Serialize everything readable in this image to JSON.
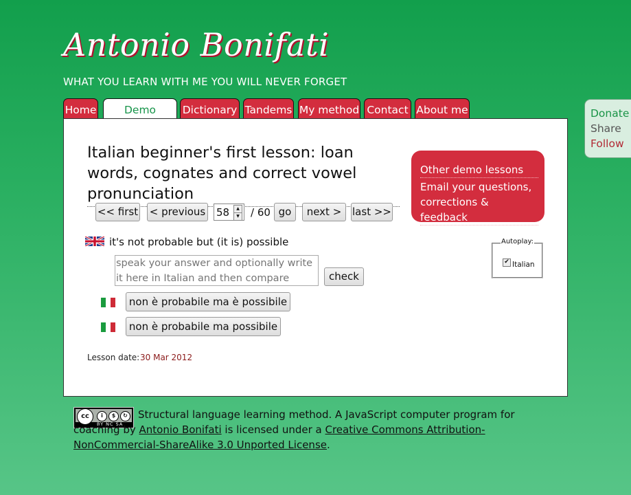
{
  "header": {
    "site_title": "Antonio Bonifati",
    "tagline": "WHAT YOU LEARN WITH ME YOU WILL NEVER FORGET"
  },
  "nav": {
    "tabs": [
      {
        "label": "Home",
        "active": false
      },
      {
        "label": "Demo lessons",
        "active": true
      },
      {
        "label": "Dictionary",
        "active": false
      },
      {
        "label": "Tandems",
        "active": false
      },
      {
        "label": "My method",
        "active": false
      },
      {
        "label": "Contact",
        "active": false
      },
      {
        "label": "About me",
        "active": false
      }
    ]
  },
  "lesson": {
    "title": "Italian beginner's first lesson: loan words, cognates and correct vowel pronunciation",
    "pagination": {
      "first_label": "<< first",
      "previous_label": "< previous",
      "current_page": "58",
      "total_label": "/ 60",
      "go_label": "go",
      "next_label": "next >",
      "last_label": "last >>"
    },
    "prompt": {
      "source_flag": "uk-flag",
      "text": "it's not probable but (it is) possible"
    },
    "answer": {
      "placeholder": "speak your answer and optionally write it here in Italian and then compare",
      "value": ""
    },
    "check_label": "check",
    "translations": [
      {
        "flag": "italy-flag",
        "text": "non è probabile ma è possibile"
      },
      {
        "flag": "italy-flag",
        "text": "non è probabile ma possibile"
      }
    ],
    "date_label": "Lesson date:",
    "date_value": "30 Mar 2012"
  },
  "side_links": {
    "other_lessons": "Other demo lessons",
    "email": "Email your questions, corrections & feedback"
  },
  "autoplay": {
    "legend": "Autoplay:",
    "option_label": "Italian",
    "checked": true
  },
  "floating": {
    "donate": "Donate",
    "share": "Share",
    "follow": "Follow"
  },
  "footer": {
    "badge_text": "BY NC SA",
    "text_1": "Structural language learning method. A JavaScript computer program for coaching by",
    "author_link": "Antonio Bonifati",
    "text_2": "is licensed under a",
    "license_link": "Creative Commons Attribution-NonCommercial-ShareAlike 3.0 Unported License",
    "text_3": "."
  },
  "colors": {
    "background_green": "#2bb062",
    "tab_red": "#d32d3e",
    "active_tab_text": "#17944a",
    "date_color": "#8b1a1a"
  }
}
